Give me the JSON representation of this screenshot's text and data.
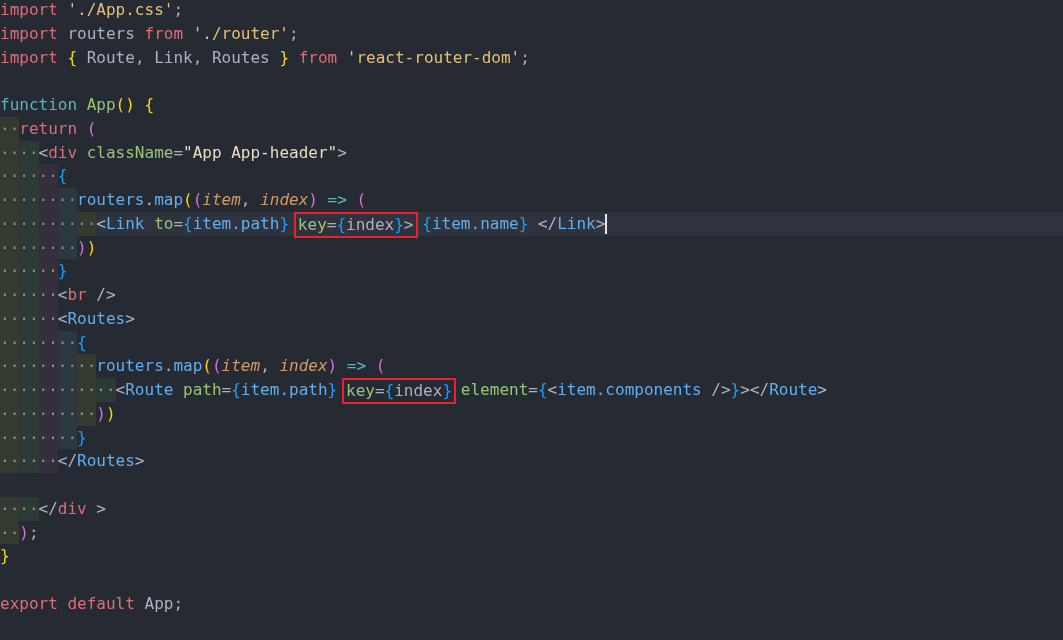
{
  "editor": {
    "lines": [
      {
        "current": false,
        "tokens": [
          {
            "kind": "kw",
            "text": "import "
          },
          {
            "kind": "str",
            "text": "'./App.css'"
          },
          {
            "kind": "plain",
            "text": ";"
          }
        ]
      },
      {
        "current": false,
        "tokens": [
          {
            "kind": "kw",
            "text": "import"
          },
          {
            "kind": "plain",
            "text": " routers "
          },
          {
            "kind": "kw",
            "text": "from "
          },
          {
            "kind": "str",
            "text": "'./router'"
          },
          {
            "kind": "plain",
            "text": ";"
          }
        ]
      },
      {
        "current": false,
        "tokens": [
          {
            "kind": "kw",
            "text": "import "
          },
          {
            "kind": "br1",
            "text": "{"
          },
          {
            "kind": "plain",
            "text": " Route, Link, Routes "
          },
          {
            "kind": "br1",
            "text": "} "
          },
          {
            "kind": "kw",
            "text": "from "
          },
          {
            "kind": "str",
            "text": "'react-router-dom'"
          },
          {
            "kind": "plain",
            "text": ";"
          }
        ]
      },
      {
        "current": false
      },
      {
        "current": false,
        "tokens": [
          {
            "kind": "fn",
            "text": "function "
          },
          {
            "kind": "attr",
            "text": "App"
          },
          {
            "kind": "br1",
            "text": "() {"
          }
        ]
      },
      {
        "current": false,
        "tokens": [
          {
            "kind": "ws",
            "text": "··"
          },
          {
            "kind": "kw",
            "text": "return "
          },
          {
            "kind": "br2",
            "text": "("
          }
        ]
      },
      {
        "current": false,
        "tokens": [
          {
            "kind": "ws",
            "text": "····"
          },
          {
            "kind": "plain",
            "text": "<"
          },
          {
            "kind": "tag",
            "text": "div "
          },
          {
            "kind": "attr",
            "text": "className"
          },
          {
            "kind": "plain",
            "text": "="
          },
          {
            "kind": "str2",
            "text": "\"App App-header\""
          },
          {
            "kind": "plain",
            "text": ">"
          }
        ]
      },
      {
        "current": false,
        "tokens": [
          {
            "kind": "ws",
            "text": "······"
          },
          {
            "kind": "br3",
            "text": "{"
          }
        ]
      },
      {
        "current": false,
        "tokens": [
          {
            "kind": "ws",
            "text": "········"
          },
          {
            "kind": "var",
            "text": "routers"
          },
          {
            "kind": "plain",
            "text": "."
          },
          {
            "kind": "var",
            "text": "map"
          },
          {
            "kind": "br1",
            "text": "("
          },
          {
            "kind": "br2",
            "text": "("
          },
          {
            "kind": "param",
            "text": "item"
          },
          {
            "kind": "plain",
            "text": ", "
          },
          {
            "kind": "param",
            "text": "index"
          },
          {
            "kind": "br2",
            "text": ") "
          },
          {
            "kind": "op",
            "text": "=> "
          },
          {
            "kind": "br2",
            "text": "("
          }
        ]
      },
      {
        "current": true,
        "tokens": [
          {
            "kind": "ws",
            "text": "··········"
          },
          {
            "kind": "plain",
            "text": "<"
          },
          {
            "kind": "comp",
            "text": "Link "
          },
          {
            "kind": "attr",
            "text": "to"
          },
          {
            "kind": "plain",
            "text": "="
          },
          {
            "kind": "br3",
            "text": "{"
          },
          {
            "kind": "var",
            "text": "item.path"
          },
          {
            "kind": "br3",
            "text": "}"
          },
          {
            "kind": "box",
            "tokens": [
              {
                "kind": "attr",
                "text": "key"
              },
              {
                "kind": "plain",
                "text": "="
              },
              {
                "kind": "br3",
                "text": "{"
              },
              {
                "kind": "plain",
                "text": "index"
              },
              {
                "kind": "br3",
                "text": "}"
              },
              {
                "kind": "plain",
                "text": ">"
              }
            ]
          },
          {
            "kind": "br3",
            "text": "{"
          },
          {
            "kind": "var",
            "text": "item.name"
          },
          {
            "kind": "br3",
            "text": "}"
          },
          {
            "kind": "plain",
            "text": " </"
          },
          {
            "kind": "comp",
            "text": "Link"
          },
          {
            "kind": "plain",
            "text": ">"
          }
        ]
      },
      {
        "current": false,
        "tokens": [
          {
            "kind": "ws",
            "text": "········"
          },
          {
            "kind": "br2",
            "text": ")"
          },
          {
            "kind": "br1",
            "text": ")"
          }
        ]
      },
      {
        "current": false,
        "tokens": [
          {
            "kind": "ws",
            "text": "······"
          },
          {
            "kind": "br3",
            "text": "}"
          }
        ]
      },
      {
        "current": false,
        "tokens": [
          {
            "kind": "ws",
            "text": "······"
          },
          {
            "kind": "plain",
            "text": "<"
          },
          {
            "kind": "tag",
            "text": "br"
          },
          {
            "kind": "plain",
            "text": " />"
          }
        ]
      },
      {
        "current": false,
        "tokens": [
          {
            "kind": "ws",
            "text": "······"
          },
          {
            "kind": "plain",
            "text": "<"
          },
          {
            "kind": "comp",
            "text": "Routes"
          },
          {
            "kind": "plain",
            "text": ">"
          }
        ]
      },
      {
        "current": false,
        "tokens": [
          {
            "kind": "ws",
            "text": "········"
          },
          {
            "kind": "br3",
            "text": "{"
          }
        ]
      },
      {
        "current": false,
        "tokens": [
          {
            "kind": "ws",
            "text": "··········"
          },
          {
            "kind": "var",
            "text": "routers"
          },
          {
            "kind": "plain",
            "text": "."
          },
          {
            "kind": "var",
            "text": "map"
          },
          {
            "kind": "br1",
            "text": "("
          },
          {
            "kind": "br2",
            "text": "("
          },
          {
            "kind": "param",
            "text": "item"
          },
          {
            "kind": "plain",
            "text": ", "
          },
          {
            "kind": "param",
            "text": "index"
          },
          {
            "kind": "br2",
            "text": ") "
          },
          {
            "kind": "op",
            "text": "=> "
          },
          {
            "kind": "br2",
            "text": "("
          }
        ]
      },
      {
        "current": false,
        "tokens": [
          {
            "kind": "ws",
            "text": "············"
          },
          {
            "kind": "plain",
            "text": "<"
          },
          {
            "kind": "comp",
            "text": "Route "
          },
          {
            "kind": "attr",
            "text": "path"
          },
          {
            "kind": "plain",
            "text": "="
          },
          {
            "kind": "br3",
            "text": "{"
          },
          {
            "kind": "var",
            "text": "item.path"
          },
          {
            "kind": "br3",
            "text": "}"
          },
          {
            "kind": "box",
            "tokens": [
              {
                "kind": "attr",
                "text": "key"
              },
              {
                "kind": "plain",
                "text": "="
              },
              {
                "kind": "br3",
                "text": "{"
              },
              {
                "kind": "plain",
                "text": "index"
              },
              {
                "kind": "br3",
                "text": "}"
              }
            ]
          },
          {
            "kind": "attr",
            "text": "element"
          },
          {
            "kind": "plain",
            "text": "="
          },
          {
            "kind": "br3",
            "text": "{"
          },
          {
            "kind": "plain",
            "text": "<"
          },
          {
            "kind": "var",
            "text": "item.components"
          },
          {
            "kind": "plain",
            "text": " />"
          },
          {
            "kind": "br3",
            "text": "}"
          },
          {
            "kind": "plain",
            "text": "></"
          },
          {
            "kind": "comp",
            "text": "Route"
          },
          {
            "kind": "plain",
            "text": ">"
          }
        ]
      },
      {
        "current": false,
        "tokens": [
          {
            "kind": "ws",
            "text": "··········"
          },
          {
            "kind": "br2",
            "text": ")"
          },
          {
            "kind": "br1",
            "text": ")"
          }
        ]
      },
      {
        "current": false,
        "tokens": [
          {
            "kind": "ws",
            "text": "········"
          },
          {
            "kind": "br3",
            "text": "}"
          }
        ]
      },
      {
        "current": false,
        "tokens": [
          {
            "kind": "ws",
            "text": "······"
          },
          {
            "kind": "plain",
            "text": "</"
          },
          {
            "kind": "comp",
            "text": "Routes"
          },
          {
            "kind": "plain",
            "text": ">"
          }
        ]
      },
      {
        "current": false
      },
      {
        "current": false,
        "tokens": [
          {
            "kind": "ws",
            "text": "····"
          },
          {
            "kind": "plain",
            "text": "</"
          },
          {
            "kind": "tag",
            "text": "div"
          },
          {
            "kind": "plain",
            "text": " >"
          }
        ]
      },
      {
        "current": false,
        "tokens": [
          {
            "kind": "ws",
            "text": "··"
          },
          {
            "kind": "br2",
            "text": ")"
          },
          {
            "kind": "plain",
            "text": ";"
          }
        ]
      },
      {
        "current": false,
        "tokens": [
          {
            "kind": "br1",
            "text": "}"
          }
        ]
      },
      {
        "current": false
      },
      {
        "current": false,
        "tokens": [
          {
            "kind": "kw",
            "text": "export default"
          },
          {
            "kind": "plain",
            "text": " App;"
          }
        ]
      }
    ]
  }
}
